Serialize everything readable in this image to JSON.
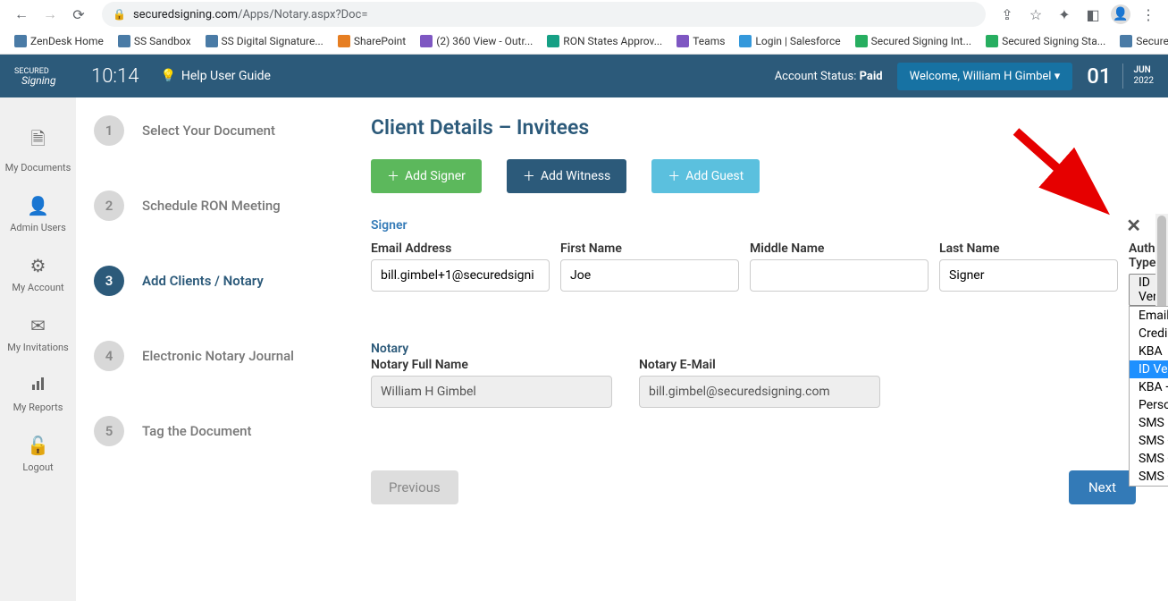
{
  "browser": {
    "url_domain": "securedsigning.com",
    "url_path": "/Apps/Notary.aspx?Doc="
  },
  "bookmarks": [
    {
      "label": "ZenDesk Home"
    },
    {
      "label": "SS Sandbox"
    },
    {
      "label": "SS Digital Signature..."
    },
    {
      "label": "SharePoint"
    },
    {
      "label": "(2) 360 View - Outr..."
    },
    {
      "label": "RON States Approv..."
    },
    {
      "label": "Teams"
    },
    {
      "label": "Login | Salesforce"
    },
    {
      "label": "Secured Signing Int..."
    },
    {
      "label": "Secured Signing Sta..."
    },
    {
      "label": "Secured Signing - A..."
    }
  ],
  "header": {
    "time": "10:14",
    "help_label": "Help User Guide",
    "account_status_label": "Account Status:",
    "account_status_value": "Paid",
    "welcome_label": "Welcome,  William H Gimbel",
    "date_day": "01",
    "date_month": "JUN",
    "date_year": "2022"
  },
  "side_nav": [
    {
      "label": "My Documents",
      "icon": "📄"
    },
    {
      "label": "Admin Users",
      "icon": "👤"
    },
    {
      "label": "My Account",
      "icon": "⚙"
    },
    {
      "label": "My Invitations",
      "icon": "✉"
    },
    {
      "label": "My Reports",
      "icon": "📊"
    },
    {
      "label": "Logout",
      "icon": "🔓"
    }
  ],
  "wizard": {
    "steps": [
      {
        "num": "1",
        "label": "Select Your Document"
      },
      {
        "num": "2",
        "label": "Schedule RON Meeting"
      },
      {
        "num": "3",
        "label": "Add Clients / Notary"
      },
      {
        "num": "4",
        "label": "Electronic Notary Journal"
      },
      {
        "num": "5",
        "label": "Tag the Document"
      }
    ],
    "active_index": 2
  },
  "panel": {
    "title": "Client Details – Invitees",
    "add_signer": "Add Signer",
    "add_witness": "Add Witness",
    "add_guest": "Add Guest",
    "signer_label": "Signer",
    "labels": {
      "email": "Email Address",
      "first": "First Name",
      "middle": "Middle Name",
      "last": "Last Name",
      "auth": "Authentication Type"
    },
    "signer": {
      "email": "bill.gimbel+1@securedsigni",
      "first": "Joe",
      "middle": "",
      "last": "Signer",
      "auth_selected": "ID Verification"
    },
    "auth_options": [
      "Email - Pass Code",
      "Credible Witness - Pass Code",
      "KBA",
      "ID Verification",
      "KBA + ID Verification",
      "Personal Knowledge",
      "SMS",
      "SMS + ID Verification",
      "SMS + KBA",
      "SMS + KBA + ID Verification"
    ],
    "notary_label": "Notary",
    "notary_name_label": "Notary Full Name",
    "notary_email_label": "Notary E-Mail",
    "notary_name": "William H Gimbel",
    "notary_email": "bill.gimbel@securedsigning.com",
    "prev_label": "Previous",
    "next_label": "Next"
  }
}
